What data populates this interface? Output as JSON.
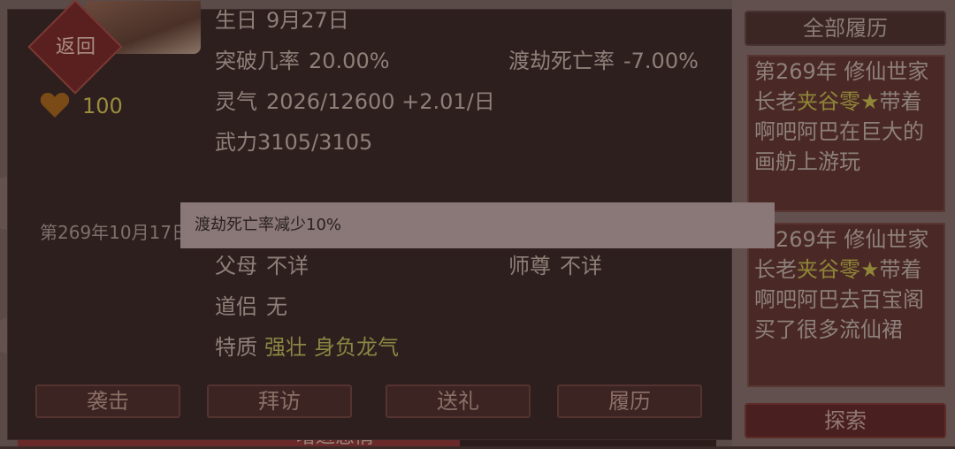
{
  "header": {
    "back_label": "返回"
  },
  "stats": {
    "hp": "100",
    "birthday_label": "生日",
    "birthday_value": "9月27日",
    "breakthrough_label": "突破几率",
    "breakthrough_value": "20.00%",
    "tribulation_label": "渡劫死亡率",
    "tribulation_value": "-7.00%",
    "qi_label": "灵气",
    "qi_value": "2026/12600 +2.01/日",
    "force": "武力3105/3105",
    "date": "第269年10月17日",
    "parents_label": "父母",
    "parents_value": "不详",
    "master_label": "师尊",
    "master_value": "不详",
    "partner_label": "道侣",
    "partner_value": "无",
    "traits_label": "特质",
    "trait_1": "强壮",
    "trait_2": "身负龙气"
  },
  "actions": {
    "attack": "袭击",
    "visit": "拜访",
    "gift": "送礼",
    "history": "履历"
  },
  "sidebar": {
    "all_history": "全部履历",
    "explore": "探索",
    "logs": [
      {
        "pre": "第269年 修仙世家长老",
        "name": "夹谷零★",
        "post": "带着啊吧阿巴在巨大的画舫上游玩"
      },
      {
        "pre": "第269年 修仙世家长老",
        "name": "夹谷零★",
        "post": "带着啊吧阿巴去百宝阁买了很多流仙裙"
      }
    ]
  },
  "background": {
    "bottom_text": "增进感情"
  },
  "toast": {
    "message": "渡劫死亡率减少10%"
  },
  "colors": {
    "panel": "#2c1f1e",
    "accent_gold": "#8f8638",
    "toast": "#8a7777"
  }
}
